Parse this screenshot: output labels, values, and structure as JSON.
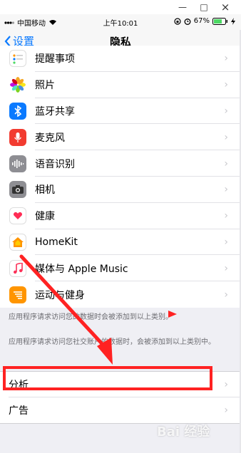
{
  "window_controls": {
    "minimize": "—",
    "maximize": "□",
    "close": "×"
  },
  "status_bar": {
    "carrier": "中国移动",
    "time": "上午10:01",
    "battery_percent": "67%"
  },
  "nav": {
    "back_label": "设置",
    "title": "隐私"
  },
  "privacy_items": [
    {
      "label": "提醒事项",
      "icon": "reminders-icon",
      "color": "#ffffff"
    },
    {
      "label": "照片",
      "icon": "photos-icon",
      "color": "#ffffff"
    },
    {
      "label": "蓝牙共享",
      "icon": "bluetooth-icon",
      "color": "#0a7aff"
    },
    {
      "label": "麦克风",
      "icon": "microphone-icon",
      "color": "#f23b30"
    },
    {
      "label": "语音识别",
      "icon": "speech-recognition-icon",
      "color": "#8e8e93"
    },
    {
      "label": "相机",
      "icon": "camera-icon",
      "color": "#8e8e93"
    },
    {
      "label": "健康",
      "icon": "health-icon",
      "color": "#ffffff"
    },
    {
      "label": "HomeKit",
      "icon": "homekit-icon",
      "color": "#ffffff"
    },
    {
      "label": "媒体与 Apple Music",
      "icon": "music-icon",
      "color": "#ffffff"
    },
    {
      "label": "运动与健身",
      "icon": "motion-fitness-icon",
      "color": "#ff9500"
    }
  ],
  "footer_notes": {
    "note1": "应用程序请求访问您的数据时会被添加到以上类别。",
    "note2": "应用程序请求访问您社交账户的数据时，会被添加到以上类别中。"
  },
  "other_items": [
    {
      "label": "分析"
    },
    {
      "label": "广告"
    }
  ],
  "watermark": "Bai 经验",
  "annotation_color": "#ff2222"
}
